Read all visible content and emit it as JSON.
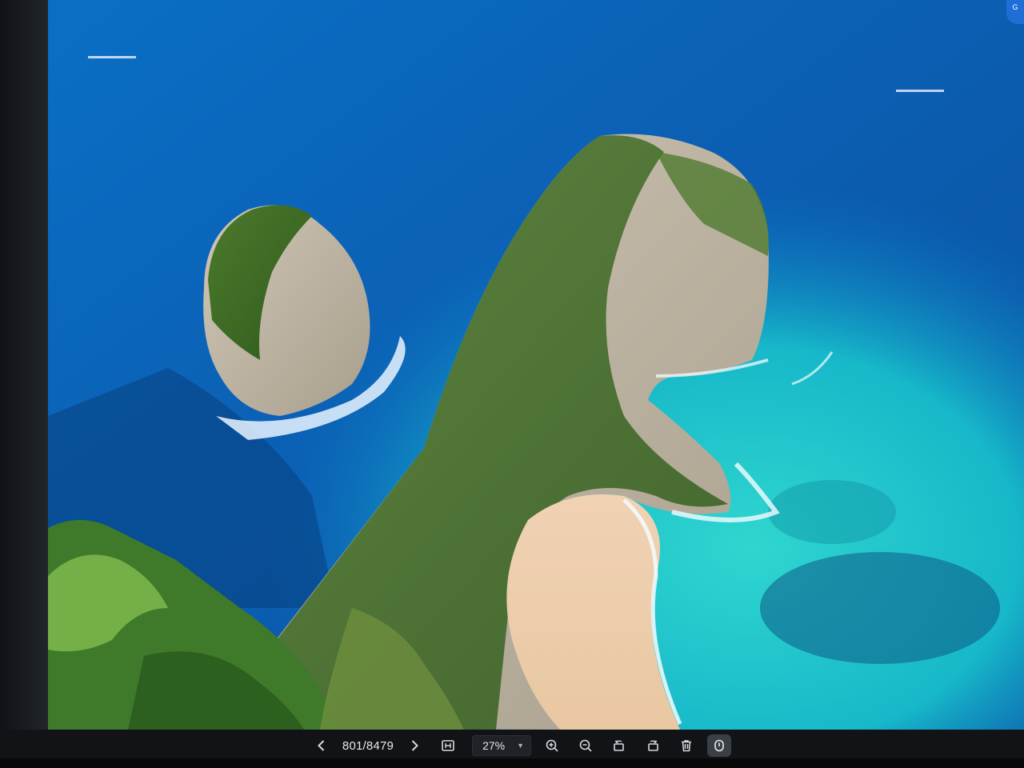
{
  "viewer": {
    "photo_subject": "sea-cliff-beach-photo",
    "corner_badge": "G"
  },
  "toolbar": {
    "counter": "801/8479",
    "zoom": "27%"
  },
  "icons": [
    "chevron-left-icon",
    "chevron-right-icon",
    "fit-icon",
    "zoom-in-icon",
    "zoom-out-icon",
    "rotate-left-icon",
    "rotate-right-icon",
    "trash-icon",
    "info-icon"
  ]
}
